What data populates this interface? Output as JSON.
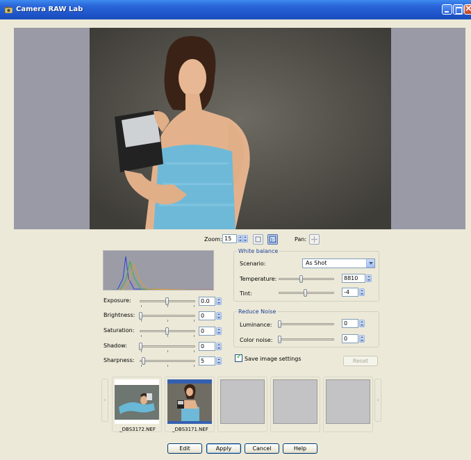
{
  "window": {
    "title": "Camera RAW Lab"
  },
  "zoom": {
    "label": "Zoom:",
    "value": "15",
    "pan_label": "Pan:"
  },
  "adjustments": [
    {
      "label": "Exposure:",
      "value": "0.0",
      "level": 0.5
    },
    {
      "label": "Brightness:",
      "value": "0",
      "level": 0.0
    },
    {
      "label": "Saturation:",
      "value": "0",
      "level": 0.5
    },
    {
      "label": "Shadow:",
      "value": "0",
      "level": 0.0
    },
    {
      "label": "Sharpness:",
      "value": "5",
      "level": 0.05
    }
  ],
  "white_balance": {
    "title": "White balance",
    "scenario_label": "Scenario:",
    "scenario_value": "As Shot",
    "temperature_label": "Temperature:",
    "temperature_value": "8810",
    "temperature_level": 0.42,
    "tint_label": "Tint:",
    "tint_value": "-4",
    "tint_level": 0.48
  },
  "reduce_noise": {
    "title": "Reduce Noise",
    "luminance_label": "Luminance:",
    "luminance_value": "0",
    "color_noise_label": "Color noise:",
    "color_noise_value": "0"
  },
  "save_settings_label": "Save image settings",
  "reset_label": "Reset",
  "filmstrip": {
    "items": [
      {
        "name": "_DBS3172.NEF"
      },
      {
        "name": "_DBS3171.NEF"
      },
      {
        "name": ""
      },
      {
        "name": ""
      },
      {
        "name": ""
      }
    ]
  },
  "buttons": {
    "edit": "Edit",
    "apply": "Apply",
    "cancel": "Cancel",
    "help": "Help"
  },
  "colors": {
    "title_bar": "#1d52c7",
    "group_title": "#1c3f95",
    "preview_bg": "#999aa5"
  }
}
